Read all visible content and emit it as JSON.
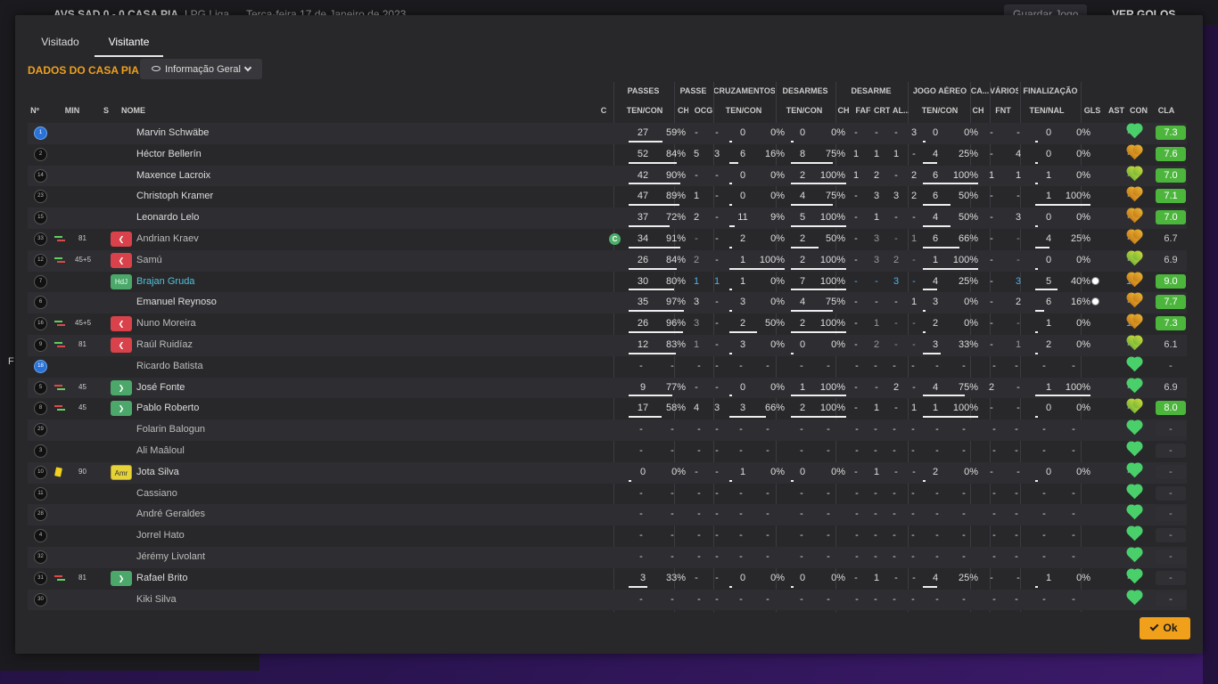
{
  "topbar": {
    "match": "AVS SAD 0 - 0 CASA PIA",
    "competition": "LPG Liga",
    "date": "Terça-feira 17 de Janeiro de 2023",
    "save": "Guardar Jogo",
    "goals": "VER GOLOS"
  },
  "background": {
    "f_label": "F"
  },
  "tabs": [
    "Visitado",
    "Visitante"
  ],
  "section_title": "DADOS DO CASA PIA",
  "view_dropdown": {
    "label": "Informação Geral"
  },
  "group_headers": [
    "PASSES",
    "PASSE",
    "CRUZAMENTOS",
    "DESARMES",
    "DESARME",
    "JOGO AÉREO",
    "CA...",
    "VÁRIOS",
    "FINALIZAÇÃO"
  ],
  "columns": {
    "no": "Nº",
    "min": "MIN",
    "s": "S",
    "name": "NOME",
    "c": "C",
    "pass_tc": "TEN/CON",
    "pass_ch": "CH",
    "pass_ocg": "OCG",
    "cross_tc": "TEN/CON",
    "tackle_tc": "TEN/CON",
    "tk_ch": "CH",
    "tk_faf": "FAF",
    "tk_crt": "CRT",
    "tk_al": "AL...",
    "air_tc": "TEN/CON",
    "ca_ch": "CH",
    "var_fnt": "FNT",
    "fin_tn": "TEN/NAL",
    "gls": "GLS",
    "ast": "AST",
    "con": "CON",
    "cla": "CLA"
  },
  "players": [
    {
      "no": "1",
      "min": "",
      "name": "Marvin Schwäbe",
      "gk": true,
      "pa": "27",
      "pp": "59%",
      "pbar": 0.59,
      "ch": "-",
      "ocg": "-",
      "ca": "0",
      "cp": "0%",
      "cbar": 0,
      "ta": "0",
      "tp": "0%",
      "tbar": 0,
      "tch": "-",
      "faf": "-",
      "crt": "-",
      "al": "3",
      "aa": "0",
      "ap": "0%",
      "abar": 0,
      "cach": "-",
      "fnt": "-",
      "fa": "0",
      "fp": "0%",
      "fbar": 0,
      "gls": "",
      "ast": "-",
      "heart": "g",
      "rating": "7.3",
      "rcls": "g"
    },
    {
      "no": "2",
      "min": "",
      "name": "Héctor Bellerín",
      "pa": "52",
      "pp": "84%",
      "pbar": 0.84,
      "ch": "5",
      "ocg": "3",
      "ca": "6",
      "cp": "16%",
      "cbar": 0.16,
      "ta": "8",
      "tp": "75%",
      "tbar": 0.75,
      "tch": "1",
      "faf": "1",
      "crt": "1",
      "al": "-",
      "aa": "4",
      "ap": "25%",
      "abar": 0.25,
      "cach": "-",
      "fnt": "4",
      "fa": "0",
      "fp": "0%",
      "fbar": 0,
      "gls": "",
      "ast": "-",
      "heart": "o",
      "rating": "7.6",
      "rcls": "g"
    },
    {
      "no": "14",
      "min": "",
      "name": "Maxence Lacroix",
      "pa": "42",
      "pp": "90%",
      "pbar": 0.9,
      "ch": "-",
      "ocg": "-",
      "ca": "0",
      "cp": "0%",
      "cbar": 0,
      "ta": "2",
      "tp": "100%",
      "tbar": 1,
      "tch": "1",
      "faf": "2",
      "crt": "-",
      "al": "2",
      "aa": "6",
      "ap": "100%",
      "abar": 1,
      "cach": "1",
      "fnt": "1",
      "fa": "1",
      "fp": "0%",
      "fbar": 0,
      "gls": "",
      "ast": "-",
      "heart": "y",
      "rating": "7.0",
      "rcls": "g"
    },
    {
      "no": "23",
      "min": "",
      "name": "Christoph Kramer",
      "pa": "47",
      "pp": "89%",
      "pbar": 0.89,
      "ch": "1",
      "ocg": "-",
      "ca": "0",
      "cp": "0%",
      "cbar": 0,
      "ta": "4",
      "tp": "75%",
      "tbar": 0.75,
      "tch": "-",
      "faf": "3",
      "crt": "3",
      "al": "2",
      "aa": "6",
      "ap": "50%",
      "abar": 0.5,
      "cach": "-",
      "fnt": "-",
      "fa": "1",
      "fp": "100%",
      "fbar": 1,
      "gls": "",
      "ast": "-",
      "heart": "o",
      "rating": "7.1",
      "rcls": "g"
    },
    {
      "no": "15",
      "min": "",
      "name": "Leonardo Lelo",
      "pa": "37",
      "pp": "72%",
      "pbar": 0.72,
      "ch": "2",
      "ocg": "-",
      "ca": "11",
      "cp": "9%",
      "cbar": 0.09,
      "ta": "5",
      "tp": "100%",
      "tbar": 1,
      "tch": "-",
      "faf": "1",
      "crt": "-",
      "al": "-",
      "aa": "4",
      "ap": "50%",
      "abar": 0.5,
      "cach": "-",
      "fnt": "3",
      "fa": "0",
      "fp": "0%",
      "fbar": 0,
      "gls": "",
      "ast": "-",
      "heart": "o",
      "rating": "7.0",
      "rcls": "g"
    },
    {
      "no": "33",
      "min": "81",
      "sub": "out",
      "badge": "out",
      "name": "Andrian Kraev",
      "cap": "C",
      "pa": "34",
      "pp": "91%",
      "pbar": 0.91,
      "ch": "-",
      "ocg": "-",
      "ca": "2",
      "cp": "0%",
      "cbar": 0,
      "ta": "2",
      "tp": "50%",
      "tbar": 0.5,
      "tch": "-",
      "faf": "3",
      "crt": "-",
      "al": "1",
      "aa": "6",
      "ap": "66%",
      "abar": 0.66,
      "cach": "-",
      "fnt": "-",
      "fa": "4",
      "fp": "25%",
      "fbar": 0.25,
      "gls": "",
      "ast": "-",
      "heart": "o",
      "rating": "6.7",
      "rcls": "plain",
      "dim": true
    },
    {
      "no": "12",
      "min": "45+5",
      "sub": "out",
      "badge": "out",
      "name": "Samú",
      "pa": "26",
      "pp": "84%",
      "pbar": 0.84,
      "ch": "2",
      "ocg": "-",
      "ca": "1",
      "cp": "100%",
      "cbar": 1,
      "ta": "2",
      "tp": "100%",
      "tbar": 1,
      "tch": "-",
      "faf": "3",
      "crt": "2",
      "al": "-",
      "aa": "1",
      "ap": "100%",
      "abar": 1,
      "cach": "-",
      "fnt": "-",
      "fa": "0",
      "fp": "0%",
      "fbar": 0,
      "gls": "",
      "ast": "-",
      "heart": "y",
      "rating": "6.9",
      "rcls": "plain",
      "dim": true
    },
    {
      "no": "7",
      "min": "",
      "badge": "hdj",
      "badge_text": "HdJ",
      "name": "Brajan Gruda",
      "hl": true,
      "pa": "30",
      "pp": "80%",
      "pbar": 0.8,
      "ch": "1",
      "ocg": "1",
      "ca": "1",
      "cp": "0%",
      "cbar": 0,
      "ta": "7",
      "tp": "100%",
      "tbar": 1,
      "tch": "-",
      "faf": "-",
      "crt": "3",
      "al": "-",
      "aa": "4",
      "ap": "25%",
      "abar": 0.25,
      "cach": "-",
      "fnt": "3",
      "fa": "5",
      "fp": "40%",
      "fbar": 0.4,
      "gls": "ball",
      "ast": "1",
      "heart": "o",
      "rating": "9.0",
      "rcls": "g"
    },
    {
      "no": "6",
      "min": "",
      "name": "Emanuel Reynoso",
      "pa": "35",
      "pp": "97%",
      "pbar": 0.97,
      "ch": "3",
      "ocg": "-",
      "ca": "3",
      "cp": "0%",
      "cbar": 0,
      "ta": "4",
      "tp": "75%",
      "tbar": 0.75,
      "tch": "-",
      "faf": "-",
      "crt": "-",
      "al": "1",
      "aa": "3",
      "ap": "0%",
      "abar": 0,
      "cach": "-",
      "fnt": "2",
      "fa": "6",
      "fp": "16%",
      "fbar": 0.16,
      "gls": "ball",
      "ast": "-",
      "heart": "o",
      "rating": "7.7",
      "rcls": "g"
    },
    {
      "no": "16",
      "min": "45+5",
      "sub": "out",
      "badge": "out",
      "name": "Nuno Moreira",
      "pa": "26",
      "pp": "96%",
      "pbar": 0.96,
      "ch": "3",
      "ocg": "-",
      "ca": "2",
      "cp": "50%",
      "cbar": 0.5,
      "ta": "2",
      "tp": "100%",
      "tbar": 1,
      "tch": "-",
      "faf": "1",
      "crt": "-",
      "al": "-",
      "aa": "2",
      "ap": "0%",
      "abar": 0,
      "cach": "-",
      "fnt": "-",
      "fa": "1",
      "fp": "0%",
      "fbar": 0,
      "gls": "",
      "ast": "1",
      "heart": "o",
      "rating": "7.3",
      "rcls": "g",
      "dim": true
    },
    {
      "no": "9",
      "min": "81",
      "sub": "out",
      "badge": "out",
      "name": "Raúl Ruidíaz",
      "pa": "12",
      "pp": "83%",
      "pbar": 0.83,
      "ch": "1",
      "ocg": "-",
      "ca": "3",
      "cp": "0%",
      "cbar": 0,
      "ta": "0",
      "tp": "0%",
      "tbar": 0,
      "tch": "-",
      "faf": "2",
      "crt": "-",
      "al": "-",
      "aa": "3",
      "ap": "33%",
      "abar": 0.33,
      "cach": "-",
      "fnt": "1",
      "fa": "2",
      "fp": "0%",
      "fbar": 0,
      "gls": "",
      "ast": "-",
      "heart": "y",
      "rating": "6.1",
      "rcls": "plain",
      "dim": true
    },
    {
      "no": "18",
      "min": "",
      "name": "Ricardo Batista",
      "gk": true,
      "empty": true,
      "heart": "g",
      "rating": "-",
      "rcls": "plain",
      "dim": true
    },
    {
      "no": "5",
      "min": "45",
      "sub": "in",
      "badge": "in",
      "name": "José Fonte",
      "pa": "9",
      "pp": "77%",
      "pbar": 0.77,
      "ch": "-",
      "ocg": "-",
      "ca": "0",
      "cp": "0%",
      "cbar": 0,
      "ta": "1",
      "tp": "100%",
      "tbar": 1,
      "tch": "-",
      "faf": "-",
      "crt": "2",
      "al": "-",
      "aa": "4",
      "ap": "75%",
      "abar": 0.75,
      "cach": "2",
      "fnt": "-",
      "fa": "1",
      "fp": "100%",
      "fbar": 1,
      "gls": "",
      "ast": "-",
      "heart": "g",
      "rating": "6.9",
      "rcls": "plain"
    },
    {
      "no": "8",
      "min": "45",
      "sub": "in",
      "badge": "in",
      "name": "Pablo Roberto",
      "pa": "17",
      "pp": "58%",
      "pbar": 0.58,
      "ch": "4",
      "ocg": "3",
      "ca": "3",
      "cp": "66%",
      "cbar": 0.66,
      "ta": "2",
      "tp": "100%",
      "tbar": 1,
      "tch": "-",
      "faf": "1",
      "crt": "-",
      "al": "1",
      "aa": "1",
      "ap": "100%",
      "abar": 1,
      "cach": "-",
      "fnt": "-",
      "fa": "0",
      "fp": "0%",
      "fbar": 0,
      "gls": "",
      "ast": "-",
      "heart": "y",
      "rating": "8.0",
      "rcls": "g"
    },
    {
      "no": "29",
      "min": "",
      "name": "Folarin Balogun",
      "empty": true,
      "heart": "g",
      "rating": "-",
      "rcls": "dash",
      "dim": true
    },
    {
      "no": "3",
      "min": "",
      "name": "Ali Maâloul",
      "empty": true,
      "heart": "g",
      "rating": "-",
      "rcls": "dash",
      "dim": true
    },
    {
      "no": "10",
      "min": "90",
      "yellow": true,
      "badge": "amr",
      "badge_text": "Amr",
      "name": "Jota Silva",
      "pa": "0",
      "pp": "0%",
      "pbar": 0,
      "ch": "-",
      "ocg": "-",
      "ca": "1",
      "cp": "0%",
      "cbar": 0,
      "ta": "0",
      "tp": "0%",
      "tbar": 0,
      "tch": "-",
      "faf": "1",
      "crt": "-",
      "al": "-",
      "aa": "2",
      "ap": "0%",
      "abar": 0,
      "cach": "-",
      "fnt": "-",
      "fa": "0",
      "fp": "0%",
      "fbar": 0,
      "gls": "",
      "ast": "-",
      "heart": "g",
      "rating": "-",
      "rcls": "dash"
    },
    {
      "no": "11",
      "min": "",
      "name": "Cassiano",
      "empty": true,
      "heart": "g",
      "rating": "-",
      "rcls": "dash",
      "dim": true
    },
    {
      "no": "28",
      "min": "",
      "name": "André Geraldes",
      "empty": true,
      "heart": "g",
      "rating": "-",
      "rcls": "dash",
      "dim": true
    },
    {
      "no": "4",
      "min": "",
      "name": "Jorrel Hato",
      "empty": true,
      "heart": "g",
      "rating": "-",
      "rcls": "dash",
      "dim": true
    },
    {
      "no": "32",
      "min": "",
      "name": "Jérémy Livolant",
      "empty": true,
      "heart": "g",
      "rating": "-",
      "rcls": "dash",
      "dim": true
    },
    {
      "no": "31",
      "min": "81",
      "sub": "in",
      "badge": "in",
      "name": "Rafael Brito",
      "pa": "3",
      "pp": "33%",
      "pbar": 0.33,
      "ch": "-",
      "ocg": "-",
      "ca": "0",
      "cp": "0%",
      "cbar": 0,
      "ta": "0",
      "tp": "0%",
      "tbar": 0,
      "tch": "-",
      "faf": "1",
      "crt": "-",
      "al": "-",
      "aa": "4",
      "ap": "25%",
      "abar": 0.25,
      "cach": "-",
      "fnt": "-",
      "fa": "1",
      "fp": "0%",
      "fbar": 0,
      "gls": "",
      "ast": "-",
      "heart": "g",
      "rating": "-",
      "rcls": "dash"
    },
    {
      "no": "30",
      "min": "",
      "name": "Kiki Silva",
      "empty": true,
      "heart": "g",
      "rating": "-",
      "rcls": "dash",
      "dim": true
    }
  ],
  "ok_button": {
    "label": "Ok"
  },
  "colors": {
    "accent": "#f0a01a",
    "rating_green": "#4cb63c",
    "out_badge": "#d9424a",
    "in_badge": "#4ca86a"
  }
}
